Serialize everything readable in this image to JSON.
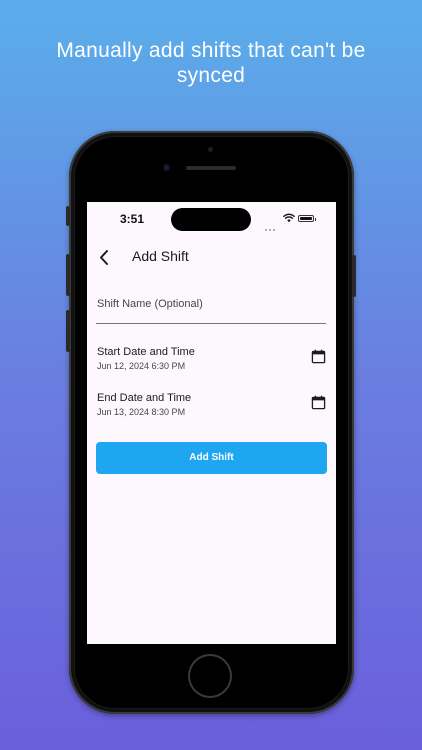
{
  "promo": {
    "headline_line1": "Manually add shifts that can't be",
    "headline_line2": "synced"
  },
  "status_bar": {
    "time": "3:51"
  },
  "app_bar": {
    "back_icon": "chevron-left-icon",
    "title": "Add Shift"
  },
  "form": {
    "shift_name": {
      "placeholder": "Shift Name (Optional)",
      "value": ""
    },
    "start": {
      "label": "Start Date and Time",
      "value": "Jun 12, 2024 6:30 PM",
      "icon": "calendar-icon"
    },
    "end": {
      "label": "End Date and Time",
      "value": "Jun 13, 2024 8:30 PM",
      "icon": "calendar-icon"
    },
    "submit_label": "Add Shift"
  },
  "colors": {
    "accent": "#1ea7f0",
    "screen_background": "#fcf8fd",
    "gradient_top": "#5aaeea",
    "gradient_bottom": "#6a5fdc"
  }
}
